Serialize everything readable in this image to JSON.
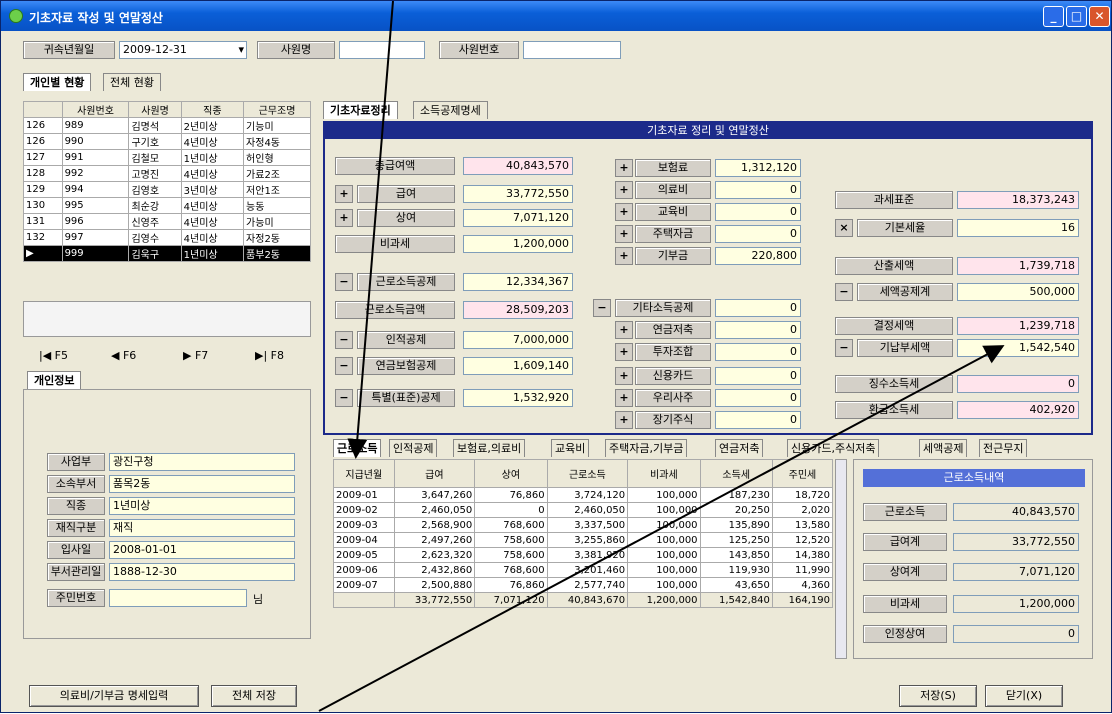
{
  "window": {
    "title": "기초자료 작성 및 연말정산"
  },
  "top": {
    "date_label": "귀속년월일",
    "date_value": "2009-12-31",
    "name_label": "사원명",
    "name_value": "",
    "empno_label": "사원번호",
    "empno_value": ""
  },
  "left_tabs": [
    "개인별 현황",
    "전체 현황"
  ],
  "emp_table": {
    "headers": [
      "",
      "사원번호",
      "사원명",
      "직종",
      "근무조명"
    ],
    "rows": [
      [
        "126",
        "989",
        "김명석",
        "2년미상",
        "기능미"
      ],
      [
        "126",
        "990",
        "구기호",
        "4년미상",
        "자정4동"
      ],
      [
        "127",
        "991",
        "김철모",
        "1년미상",
        "허인형"
      ],
      [
        "128",
        "992",
        "고명진",
        "4년미상",
        "가료2조"
      ],
      [
        "129",
        "994",
        "김영호",
        "3년미상",
        "저안1조"
      ],
      [
        "130",
        "995",
        "최순강",
        "4년미상",
        "능동"
      ],
      [
        "131",
        "996",
        "신영주",
        "4년미상",
        "가능미"
      ],
      [
        "132",
        "997",
        "김영수",
        "4년미상",
        "자정2동"
      ],
      [
        "▶",
        "999",
        "김욱구",
        "1년미상",
        "품부2동"
      ]
    ]
  },
  "nav": [
    "F5",
    "F6",
    "F7",
    "F8"
  ],
  "personal_tab": "개인정보",
  "personal": [
    {
      "label": "사업부",
      "value": "광진구청"
    },
    {
      "label": "소속부서",
      "value": "품목2동"
    },
    {
      "label": "직종",
      "value": "1년미상"
    },
    {
      "label": "재직구분",
      "value": "재직"
    },
    {
      "label": "입사일",
      "value": "2008-01-01"
    },
    {
      "label": "부서관리일",
      "value": "1888-12-30"
    },
    {
      "label": "주민번호",
      "value": "",
      "suffix": "님"
    }
  ],
  "main_tabs": [
    "기초자료정리",
    "소득공제명세"
  ],
  "panel_title": "기초자료 정리 및 연말정산",
  "col1": {
    "total_label": "총급여액",
    "total": "40,843,570",
    "salary_label": "급여",
    "salary": "33,772,550",
    "bonus_label": "상여",
    "bonus": "7,071,120",
    "nontax_label": "비과세",
    "nontax": "1,200,000",
    "ded_label": "근로소득공제",
    "ded": "12,334,367",
    "inc_label": "근로소득금액",
    "inc": "28,509,203",
    "basic_label": "인적공제",
    "basic": "7,000,000",
    "ins_label": "연금보험공제",
    "ins": "1,609,140",
    "special_label": "특별(표준)공제",
    "special": "1,532,920"
  },
  "col2": {
    "items": [
      {
        "op": "+",
        "label": "보험료",
        "value": "1,312,120"
      },
      {
        "op": "+",
        "label": "의료비",
        "value": "0"
      },
      {
        "op": "+",
        "label": "교육비",
        "value": "0"
      },
      {
        "op": "+",
        "label": "주택자금",
        "value": "0"
      },
      {
        "op": "+",
        "label": "기부금",
        "value": "220,800"
      }
    ],
    "other_label": "기타소득공제",
    "other": "0",
    "items2": [
      {
        "op": "+",
        "label": "연금저축",
        "value": "0"
      },
      {
        "op": "+",
        "label": "투자조합",
        "value": "0"
      },
      {
        "op": "+",
        "label": "신용카드",
        "value": "0"
      },
      {
        "op": "+",
        "label": "우리사주",
        "value": "0"
      },
      {
        "op": "+",
        "label": "장기주식",
        "value": "0"
      }
    ]
  },
  "col3": {
    "std_label": "과세표준",
    "std": "18,373,243",
    "rate_label": "기본세율",
    "rate": "16",
    "calc_label": "산출세액",
    "calc": "1,739,718",
    "credit_label": "세액공제계",
    "credit": "500,000",
    "det_label": "결정세액",
    "det": "1,239,718",
    "paid_label": "기납부세액",
    "paid": "1,542,540",
    "inc_label": "징수소득세",
    "inc": "0",
    "local_label": "환급소득세",
    "local": "402,920"
  },
  "sub_tabs": [
    "근로소득",
    "인적공제",
    "보험료,의료비",
    "교육비",
    "주택자금,기부금",
    "연금저축",
    "신용카드,주식저축",
    "세액공제",
    "전근무지"
  ],
  "monthly": {
    "headers": [
      "지급년월",
      "급여",
      "상여",
      "근로소득",
      "비과세",
      "소득세",
      "주민세"
    ],
    "rows": [
      [
        "2009-01",
        "3,647,260",
        "76,860",
        "3,724,120",
        "100,000",
        "187,230",
        "18,720"
      ],
      [
        "2009-02",
        "2,460,050",
        "0",
        "2,460,050",
        "100,000",
        "20,250",
        "2,020"
      ],
      [
        "2009-03",
        "2,568,900",
        "768,600",
        "3,337,500",
        "100,000",
        "135,890",
        "13,580"
      ],
      [
        "2009-04",
        "2,497,260",
        "758,600",
        "3,255,860",
        "100,000",
        "125,250",
        "12,520"
      ],
      [
        "2009-05",
        "2,623,320",
        "758,600",
        "3,381,920",
        "100,000",
        "143,850",
        "14,380"
      ],
      [
        "2009-06",
        "2,432,860",
        "768,600",
        "3,201,460",
        "100,000",
        "119,930",
        "11,990"
      ],
      [
        "2009-07",
        "2,500,880",
        "76,860",
        "2,577,740",
        "100,000",
        "43,650",
        "4,360"
      ]
    ],
    "totals": [
      "",
      "33,772,550",
      "7,071,120",
      "40,843,670",
      "1,200,000",
      "1,542,840",
      "164,190"
    ]
  },
  "summary": {
    "title": "근로소득내역",
    "items": [
      {
        "label": "근로소득",
        "value": "40,843,570"
      },
      {
        "label": "급여계",
        "value": "33,772,550"
      },
      {
        "label": "상여계",
        "value": "7,071,120"
      },
      {
        "label": "비과세",
        "value": "1,200,000"
      },
      {
        "label": "인정상여",
        "value": "0"
      }
    ]
  },
  "bottom": {
    "b1": "의료비/기부금 명세입력",
    "b2": "전체 저장",
    "b3": "저장(S)",
    "b4": "닫기(X)"
  }
}
